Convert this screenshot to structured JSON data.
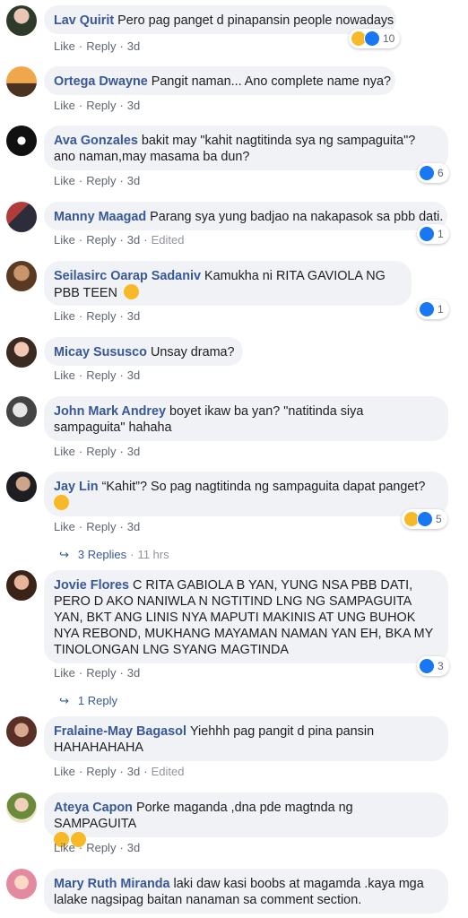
{
  "actions": {
    "like": "Like",
    "reply": "Reply",
    "dot": "·",
    "edited": "Edited"
  },
  "comments": [
    {
      "author": "Lav Quirit",
      "text": "Pero pag panget d pinapansin people nowadays",
      "time": "3d",
      "reactions": "10",
      "reaction_types": [
        "haha-icon",
        "like-icon"
      ]
    },
    {
      "author": "Ortega Dwayne",
      "text": "Pangit naman... Ano complete name nya?",
      "time": "3d"
    },
    {
      "author": "Ava Gonzales",
      "text": "bakit may \"kahit nagtitinda sya ng sampaguita\"? ano naman,may masama ba dun?",
      "time": "3d",
      "reactions": "6",
      "reaction_types": [
        "like-icon"
      ]
    },
    {
      "author": "Manny Maagad",
      "text": "Parang sya yung badjao na nakapasok sa pbb dati.",
      "time": "3d",
      "edited": true,
      "reactions": "1",
      "reaction_types": [
        "like-icon"
      ]
    },
    {
      "author": "Seilasirc Oarap Sadaniv",
      "text": "Kamukha ni RITA GAVIOLA NG PBB TEEN",
      "time": "3d",
      "reactions": "1",
      "reaction_types": [
        "like-icon"
      ]
    },
    {
      "author": "Micay Sususco",
      "text": "Unsay drama?",
      "time": "3d"
    },
    {
      "author": "John Mark Andrey",
      "text": "boyet ikaw ba yan? \"natitinda siya sampaguita\" hahaha",
      "time": "3d"
    },
    {
      "author": "Jay Lin",
      "text": "“Kahit”? So pag nagtitinda ng sampaguita dapat panget?",
      "time": "3d",
      "reactions": "5",
      "reaction_types": [
        "haha-icon",
        "like-icon"
      ],
      "replies": "3 Replies",
      "replies_time": "11 hrs"
    },
    {
      "author": "Jovie Flores",
      "text": "C RITA GABIOLA B YAN, YUNG NSA PBB DATI, PERO D AKO NANIWLA N NGTITIND LNG NG SAMPAGUITA YAN, BKT ANG LINIS NYA MAPUTI MAKINIS AT UNG BUHOK NYA REBOND, MUKHANG MAYAMAN NAMAN YAN EH, BKA MY TINOLONGAN LNG SYANG MAGTINDA",
      "time": "3d",
      "reactions": "3",
      "reaction_types": [
        "like-icon"
      ],
      "replies": "1 Reply"
    },
    {
      "author": "Fralaine-May Bagasol",
      "text": "Yiehhh pag pangit d pina pansin HAHAHAHAHA",
      "time": "3d",
      "edited": true
    },
    {
      "author": "Ateya Capon",
      "text": "Porke maganda ,dna pde magtnda ng SAMPAGUITA",
      "time": "3d"
    },
    {
      "author": "Mary Ruth Miranda",
      "text": "laki daw kasi boobs at magamda .kaya mga lalake nagsipag baitan nanaman sa comment section."
    }
  ],
  "colors": {
    "author": "#385898",
    "bubble": "#f0f2f5",
    "like": "#1877f2",
    "haha": "#f7b928"
  }
}
